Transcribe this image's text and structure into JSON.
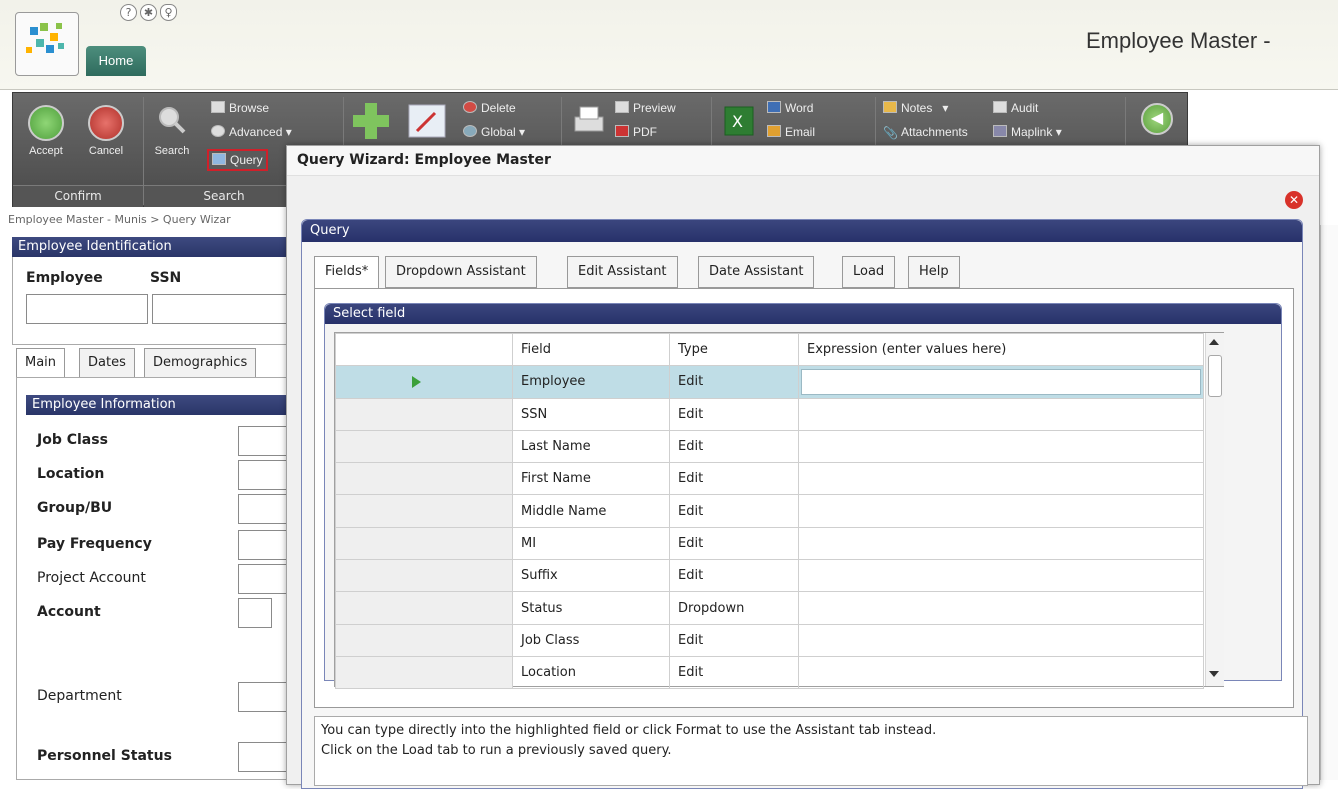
{
  "header": {
    "home_tab": "Home",
    "app_title": "Employee Master -",
    "help_icons": [
      "help-icon",
      "settings-gear-icon",
      "lightbulb-icon"
    ]
  },
  "ribbon": {
    "accept": "Accept",
    "cancel": "Cancel",
    "search": "Search",
    "browse": "Browse",
    "advanced": "Advanced",
    "query": "Query",
    "delete": "Delete",
    "global": "Global",
    "preview": "Preview",
    "pdf": "PDF",
    "word": "Word",
    "email": "Email",
    "notes": "Notes",
    "audit": "Audit",
    "attachments": "Attachments",
    "maplink": "Maplink",
    "group_confirm": "Confirm",
    "group_search": "Search"
  },
  "breadcrumb": "Employee Master - Munis > Query Wizar",
  "left": {
    "ident_header": "Employee Identification",
    "employee_label": "Employee",
    "ssn_label": "SSN",
    "tabs": [
      "Main",
      "Dates",
      "Demographics"
    ],
    "info_header": "Employee Information",
    "fields": [
      "Job Class",
      "Location",
      "Group/BU",
      "Pay Frequency",
      "Project Account",
      "Account",
      "Department",
      "Personnel Status"
    ]
  },
  "dialog": {
    "title": "Query Wizard: Employee Master",
    "query_header": "Query",
    "tabs": [
      "Fields*",
      "Dropdown Assistant",
      "Edit Assistant",
      "Date Assistant",
      "Load",
      "Help"
    ],
    "select_header": "Select field",
    "columns": [
      "Field",
      "Type",
      "Expression (enter values here)"
    ],
    "rows": [
      {
        "field": "Employee",
        "type": "Edit"
      },
      {
        "field": "SSN",
        "type": "Edit"
      },
      {
        "field": "Last Name",
        "type": "Edit"
      },
      {
        "field": "First Name",
        "type": "Edit"
      },
      {
        "field": "Middle Name",
        "type": "Edit"
      },
      {
        "field": "MI",
        "type": "Edit"
      },
      {
        "field": "Suffix",
        "type": "Edit"
      },
      {
        "field": "Status",
        "type": "Dropdown"
      },
      {
        "field": "Job Class",
        "type": "Edit"
      },
      {
        "field": "Location",
        "type": "Edit"
      }
    ],
    "info_line1": "You can type directly into the highlighted field or click Format to use the Assistant tab instead.",
    "info_line2": "Click on the Load tab to run a previously saved query."
  },
  "colors": {
    "section_header": "#2f3a70",
    "selected_row": "#bfdde6",
    "highlight_box": "#d0202a",
    "accept_green": "#6fbf5a",
    "cancel_red": "#c8453f"
  }
}
